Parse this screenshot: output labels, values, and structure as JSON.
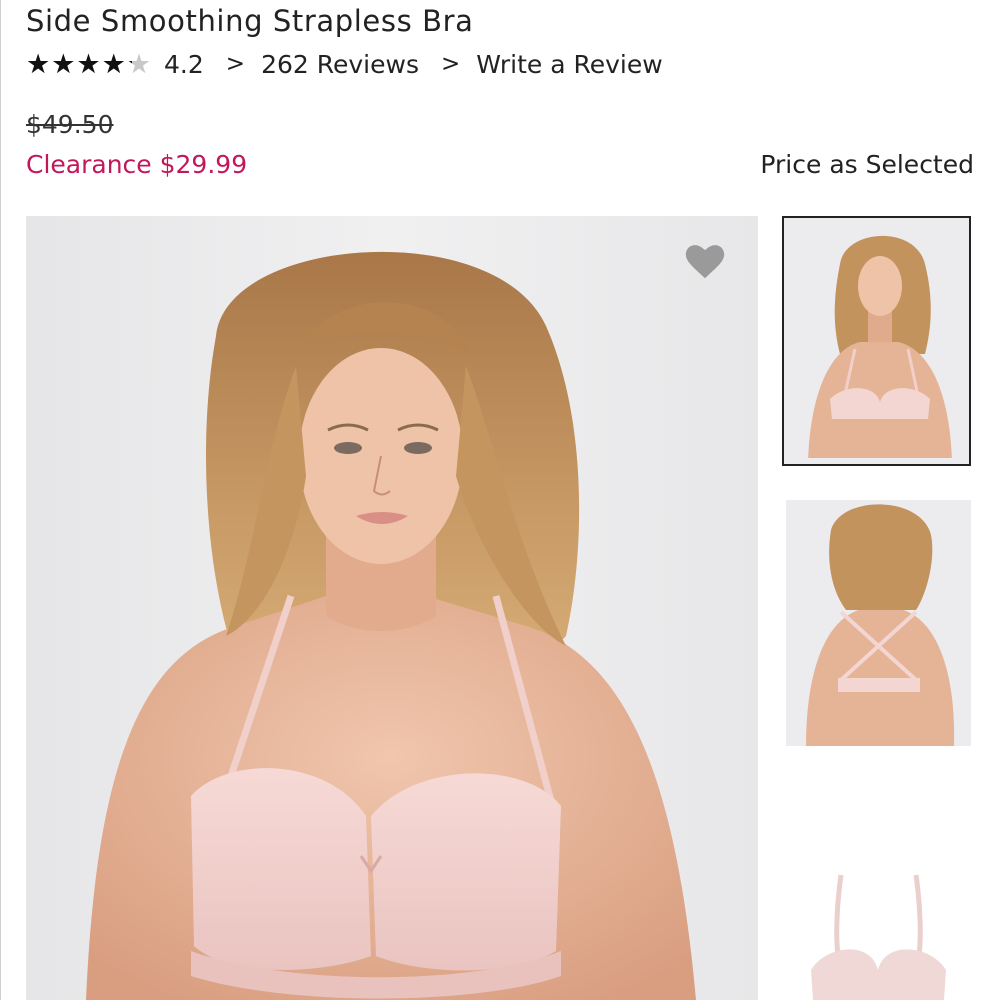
{
  "product": {
    "title": "Side Smoothing Strapless Bra",
    "rating": 4.2,
    "rating_text": "4.2",
    "stars": "★★★★★",
    "chevron": ">",
    "reviews_link": "262 Reviews",
    "write_review_link": "Write a Review"
  },
  "pricing": {
    "original": "$49.50",
    "sale": "Clearance $29.99",
    "price_note": "Price as Selected",
    "sale_color": "#c2185b"
  },
  "gallery": {
    "wishlist_icon": "heart-icon",
    "thumbnails": [
      "front-view",
      "back-view",
      "product-only"
    ],
    "selected_index": 0
  }
}
